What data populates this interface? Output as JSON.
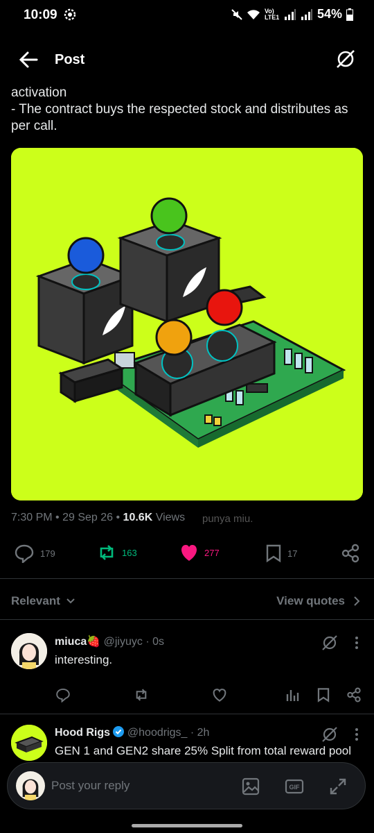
{
  "status": {
    "time": "10:09",
    "network": "Vo) LTE1",
    "battery": "54%"
  },
  "header": {
    "title": "Post"
  },
  "post": {
    "text": "activation\n- The contract buys the respected stock and distributes as per call.",
    "time": "7:30 PM",
    "date": "29 Sep 26",
    "views_count": "10.6K",
    "views_label": "Views",
    "overlay_text": "punya miu.",
    "actions": {
      "replies": "179",
      "reposts": "163",
      "likes": "277",
      "bookmarks": "17"
    },
    "colors": {
      "repost": "#00ba7c",
      "like": "#f91880",
      "media_bg": "#ccff1a"
    }
  },
  "sort": {
    "label": "Relevant",
    "view_quotes": "View quotes"
  },
  "replies": [
    {
      "name": "miuca🍓",
      "handle": "@jiyuyc",
      "time": "· 0s",
      "text": "interesting."
    },
    {
      "name": "Hood Rigs",
      "verified": true,
      "handle": "@hoodrigs_",
      "time": "· 2h",
      "text": "GEN 1 and GEN2 share 25% Split from total reward pool"
    }
  ],
  "reply_bar": {
    "placeholder": "Post your reply"
  },
  "icons": [
    "back-arrow-icon",
    "grok-icon",
    "reply-icon",
    "repost-icon",
    "like-icon",
    "bookmark-icon",
    "share-icon",
    "chevron-down-icon",
    "chevron-right-icon",
    "more-icon",
    "views-icon",
    "image-icon",
    "gif-icon",
    "expand-icon",
    "verified-icon"
  ]
}
